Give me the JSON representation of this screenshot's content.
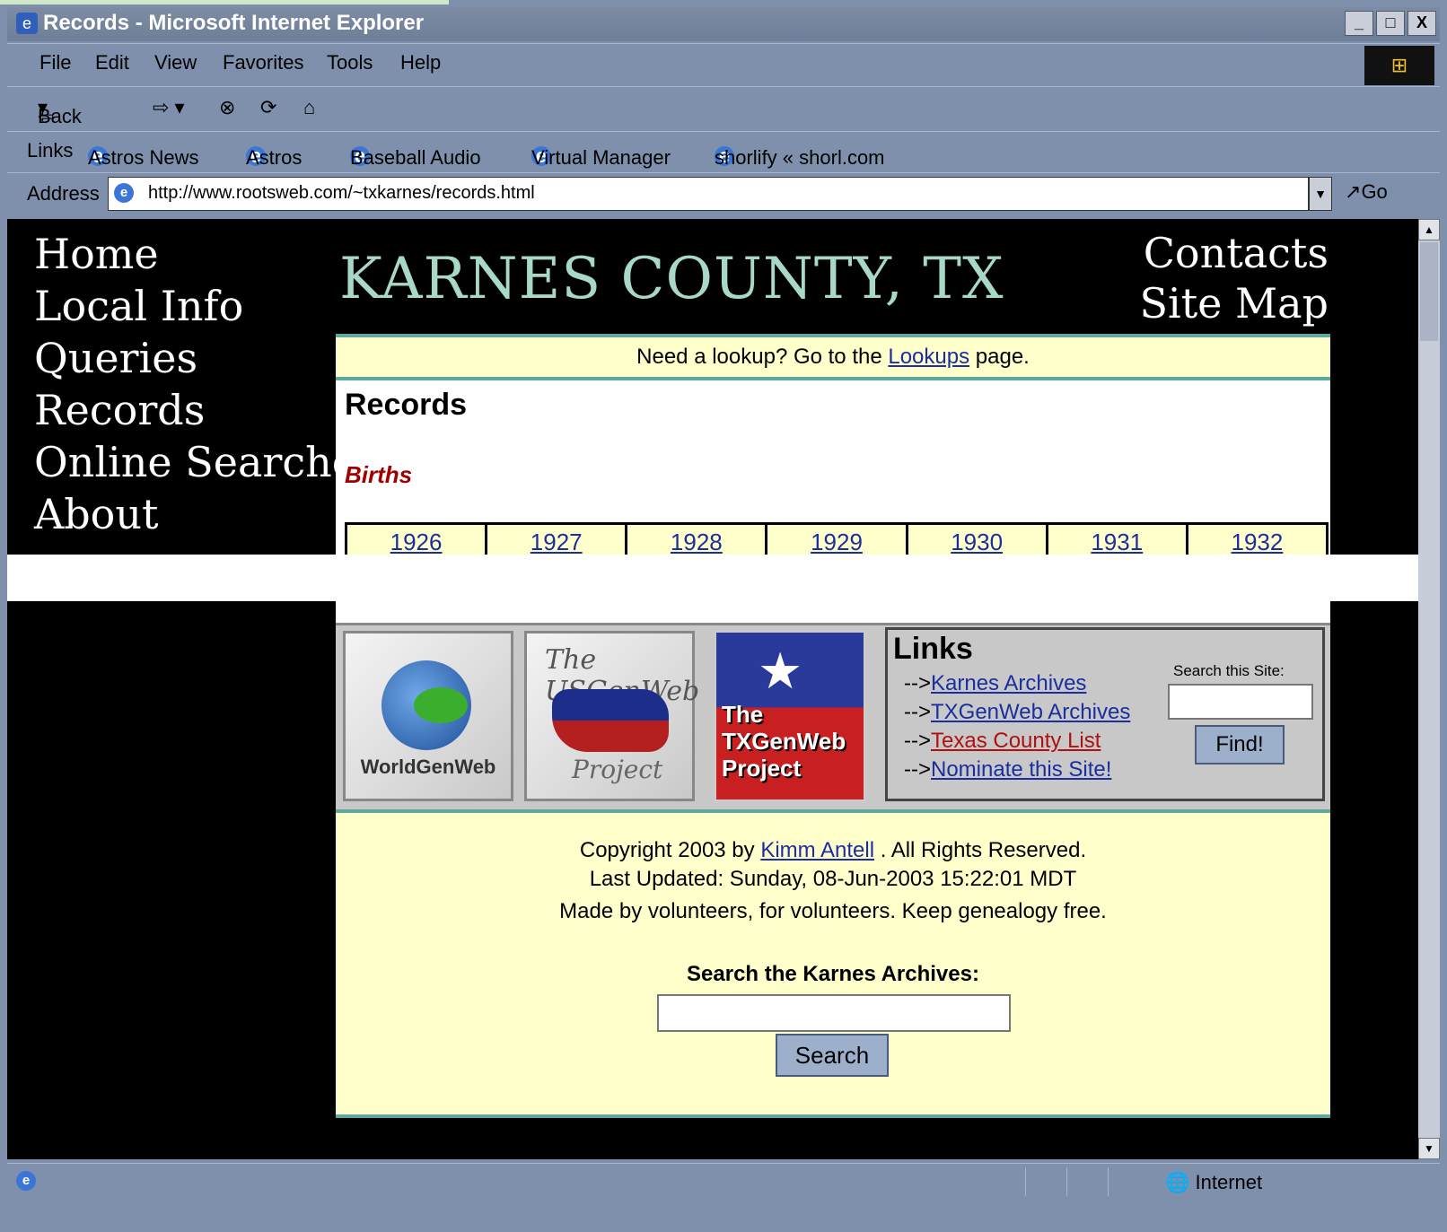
{
  "window": {
    "title": "Records - Microsoft Internet Explorer",
    "buttons": [
      "_",
      "□",
      "X"
    ]
  },
  "menu": [
    "File",
    "Edit",
    "View",
    "Favorites",
    "Tools",
    "Help"
  ],
  "toolbar": {
    "back": "Back"
  },
  "links": {
    "label": "Links",
    "items": [
      "Astros News",
      "Astros",
      "Baseball Audio",
      "Virtual Manager",
      "shorlify « shorl.com"
    ]
  },
  "address": {
    "label": "Address",
    "url": "http://www.rootsweb.com/~txkarnes/records.html",
    "go": "Go"
  },
  "nav": [
    "Home",
    "Local Info",
    "Queries",
    "Records",
    "Online Searches",
    "About"
  ],
  "header": {
    "title": "KARNES COUNTY, TX",
    "contacts": "Contacts",
    "sitemap": "Site Map"
  },
  "lookup": {
    "pre": "Need a lookup? Go to the ",
    "link": "Lookups",
    "post": " page."
  },
  "main": {
    "heading": "Records",
    "births": "Births",
    "years": [
      "1926",
      "1927",
      "1928",
      "1929",
      "1930",
      "1931",
      "1932"
    ]
  },
  "logos": {
    "worldgenweb": "WorldGenWeb",
    "usgenweb_top": "The USGenWeb",
    "usgenweb_bottom": "Project",
    "txgenweb": "The TXGenWeb Project"
  },
  "linkspanel": {
    "title": "Links",
    "items": [
      {
        "prefix": "-->",
        "label": "Karnes Archives"
      },
      {
        "prefix": "-->",
        "label": "TXGenWeb Archives"
      },
      {
        "prefix": "-->",
        "label": "Texas County List"
      },
      {
        "prefix": "-->",
        "label": "Nominate this Site!"
      }
    ],
    "search_label": "Search this Site:",
    "find_button": "Find!"
  },
  "footer": {
    "copyright_pre": "Copyright 2003 by ",
    "copyright_link": "Kimm Antell",
    "copyright_post": " . All Rights Reserved.",
    "updated": "Last Updated: Sunday, 08-Jun-2003 15:22:01 MDT",
    "volunteers": "Made by volunteers, for volunteers. Keep genealogy free.",
    "search_heading": "Search the Karnes Archives:",
    "search_button": "Search"
  },
  "status": {
    "zone": "Internet"
  }
}
